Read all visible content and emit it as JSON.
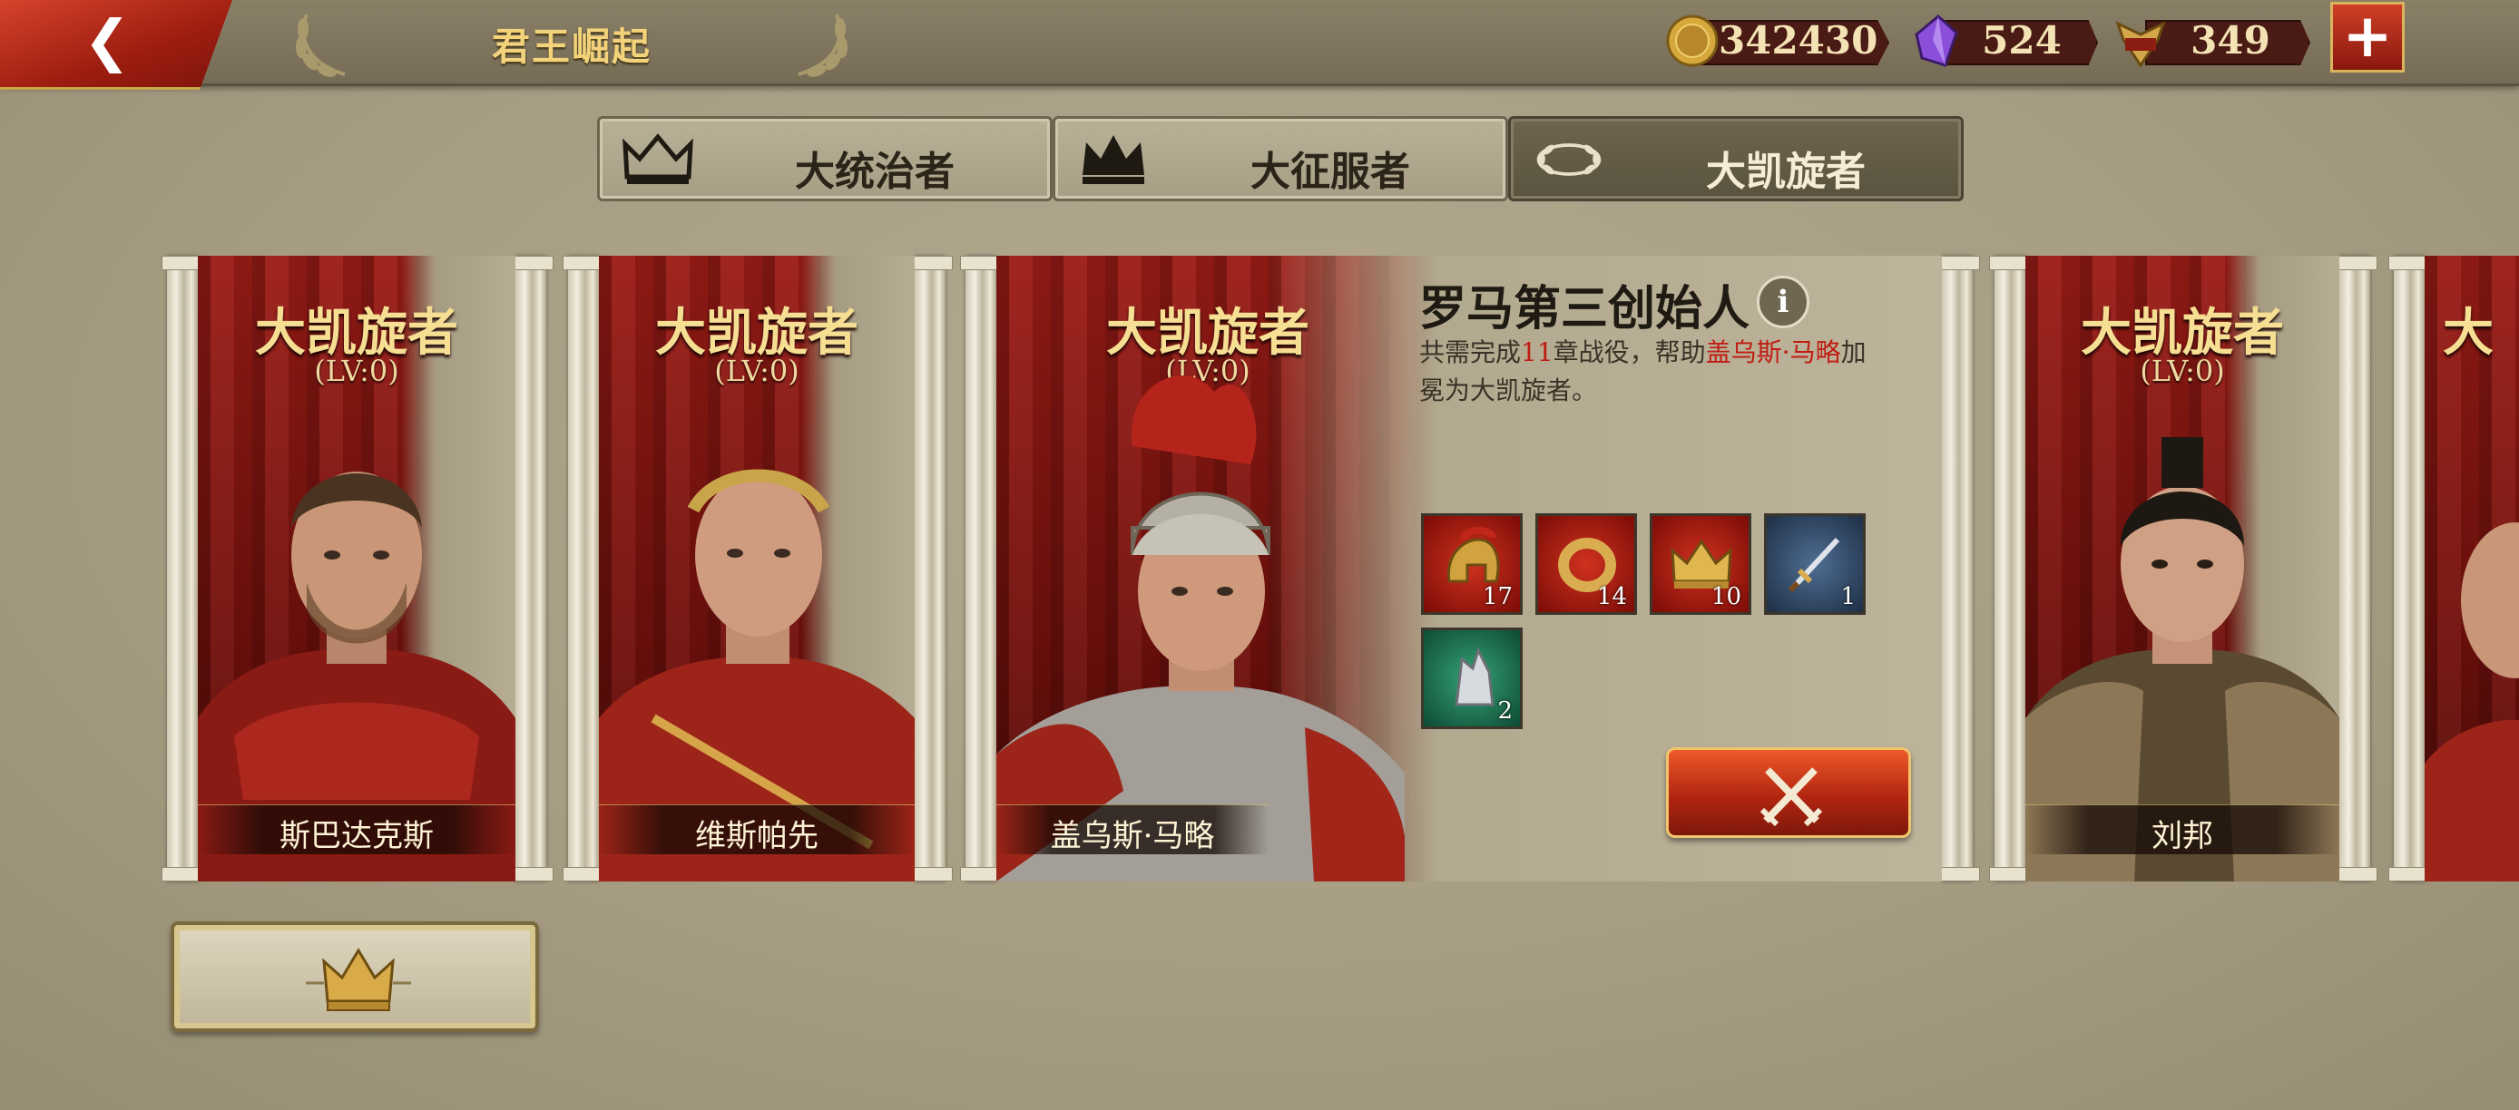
{
  "header": {
    "title": "君王崛起",
    "back_icon": "back-arrow-icon",
    "resources": [
      {
        "name": "gold",
        "icon": "gold-coin-icon",
        "value": "342430"
      },
      {
        "name": "gem",
        "icon": "purple-gem-icon",
        "value": "524"
      },
      {
        "name": "spqr",
        "icon": "spqr-eagle-icon",
        "value": "349"
      }
    ],
    "plus_label": "+"
  },
  "tabs": [
    {
      "label": "大统治者",
      "icon": "crown-icon",
      "active": false
    },
    {
      "label": "大征服者",
      "icon": "spiked-crown-icon",
      "active": false
    },
    {
      "label": "大凯旋者",
      "icon": "laurel-wreath-icon",
      "active": true
    }
  ],
  "cards": [
    {
      "title": "大凯旋者",
      "level": "(LV:0)",
      "name": "斯巴达克斯"
    },
    {
      "title": "大凯旋者",
      "level": "(LV:0)",
      "name": "维斯帕先"
    },
    {
      "title": "大凯旋者",
      "level": "(LV:0)",
      "name": "盖乌斯·马略"
    },
    {
      "title": "大凯旋者",
      "level": "(LV:0)",
      "name": "刘邦"
    },
    {
      "title": "大",
      "level": "",
      "name": ""
    }
  ],
  "detail": {
    "title": "罗马第三创始人",
    "info_icon": "i",
    "desc_prefix": "共需完成",
    "desc_count": "11",
    "desc_mid": "章战役，帮助",
    "desc_hero": "盖乌斯·马略",
    "desc_suffix": "加冕为大凯旋者。",
    "rewards": [
      {
        "icon": "helmet-icon",
        "count": "17"
      },
      {
        "icon": "ring-icon",
        "count": "14"
      },
      {
        "icon": "crown-item-icon",
        "count": "10"
      },
      {
        "icon": "sword-icon",
        "count": "1"
      },
      {
        "icon": "silver-crystal-icon",
        "count": "2"
      }
    ],
    "battle_icon": "crossed-swords-icon"
  },
  "footer": {
    "crown_button_icon": "crown-icon"
  },
  "colors": {
    "accent_red": "#b32610",
    "gold_text": "#f6df93",
    "highlight": "#c01c12"
  }
}
